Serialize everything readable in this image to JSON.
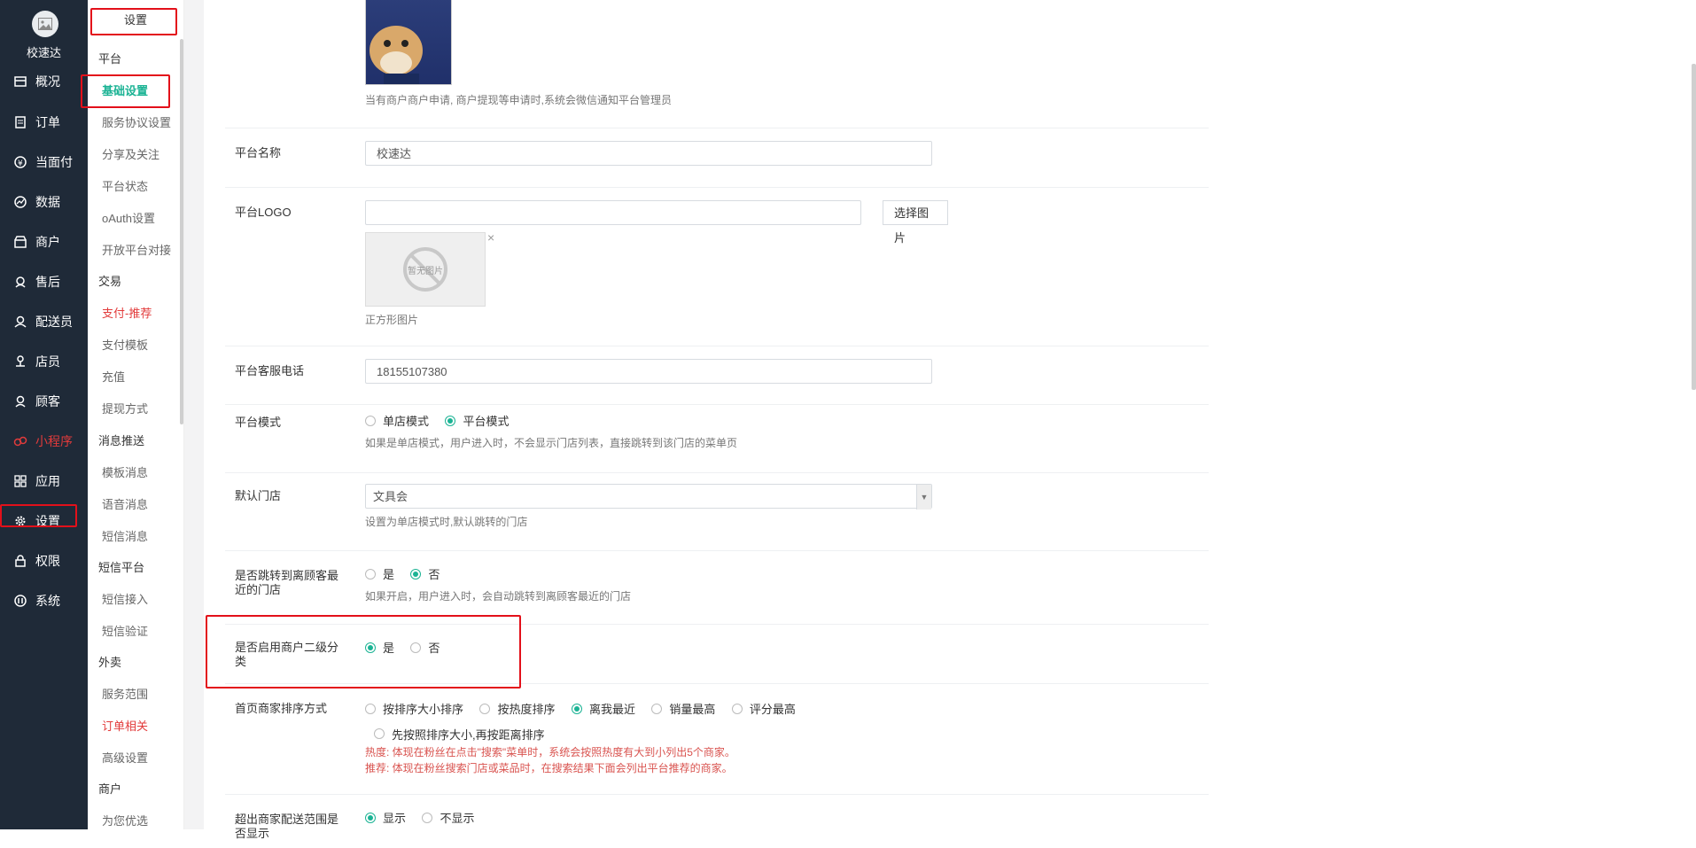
{
  "nav": {
    "brand": "校速达",
    "items": [
      {
        "label": "概况",
        "icon": "overview-icon"
      },
      {
        "label": "订单",
        "icon": "order-icon"
      },
      {
        "label": "当面付",
        "icon": "yuan-icon"
      },
      {
        "label": "数据",
        "icon": "chart-icon"
      },
      {
        "label": "商户",
        "icon": "store-icon"
      },
      {
        "label": "售后",
        "icon": "service-icon"
      },
      {
        "label": "配送员",
        "icon": "courier-icon"
      },
      {
        "label": "店员",
        "icon": "clerk-icon"
      },
      {
        "label": "顾客",
        "icon": "customer-icon"
      },
      {
        "label": "小程序",
        "icon": "miniprogram-icon"
      },
      {
        "label": "应用",
        "icon": "apps-icon"
      },
      {
        "label": "设置",
        "icon": "gear-icon"
      },
      {
        "label": "权限",
        "icon": "lock-icon"
      },
      {
        "label": "系统",
        "icon": "system-icon"
      }
    ]
  },
  "sub": {
    "title": "设置",
    "groups": {
      "platform": "平台",
      "trade": "交易",
      "message": "消息推送",
      "sms": "短信平台",
      "takeaway": "外卖",
      "merchant": "商户"
    },
    "items": {
      "basic": "基础设置",
      "agreement": "服务协议设置",
      "share": "分享及关注",
      "status": "平台状态",
      "oauth": "oAuth设置",
      "openplatform": "开放平台对接",
      "pay_recommend": "支付-推荐",
      "pay_template": "支付模板",
      "recharge": "充值",
      "withdraw": "提现方式",
      "template_msg": "模板消息",
      "voice_msg": "语音消息",
      "sms_msg": "短信消息",
      "sms_access": "短信接入",
      "sms_verify": "短信验证",
      "service_range": "服务范围",
      "order_related": "订单相关",
      "advanced": "高级设置",
      "recommend": "为您优选"
    }
  },
  "form": {
    "admin_help": "当有商户商户申请, 商户提现等申请时,系统会微信通知平台管理员",
    "platform_name_label": "平台名称",
    "platform_name_value": "校速达",
    "logo_label": "平台LOGO",
    "logo_value": "",
    "choose_image": "选择图片",
    "no_image": "暂无图片",
    "logo_help": "正方形图片",
    "phone_label": "平台客服电话",
    "phone_value": "18155107380",
    "mode_label": "平台模式",
    "mode_single": "单店模式",
    "mode_platform": "平台模式",
    "mode_help": "如果是单店模式，用户进入时，不会显示门店列表，直接跳转到该门店的菜单页",
    "default_store_label": "默认门店",
    "default_store_value": "文具会",
    "default_store_help": "设置为单店模式时,默认跳转的门店",
    "nearest_label": "是否跳转到离顾客最近的门店",
    "yes": "是",
    "no": "否",
    "nearest_help": "如果开启，用户进入时，会自动跳转到离顾客最近的门店",
    "secondary_label": "是否启用商户二级分类",
    "sort_label": "首页商家排序方式",
    "sort_options": [
      "按排序大小排序",
      "按热度排序",
      "离我最近",
      "销量最高",
      "评分最高",
      "先按照排序大小,再按距离排序"
    ],
    "sort_help_1": "热度: 体现在粉丝在点击\"搜索\"菜单时，系统会按照热度有大到小列出5个商家。",
    "sort_help_2": "推荐: 体现在粉丝搜索门店或菜品时，在搜索结果下面会列出平台推荐的商家。",
    "outrange_label": "超出商家配送范围是否显示",
    "show": "显示",
    "hide": "不显示"
  },
  "colors": {
    "nav_bg": "#1f2a38",
    "accent": "#1bb394",
    "highlight": "#e3101a"
  }
}
